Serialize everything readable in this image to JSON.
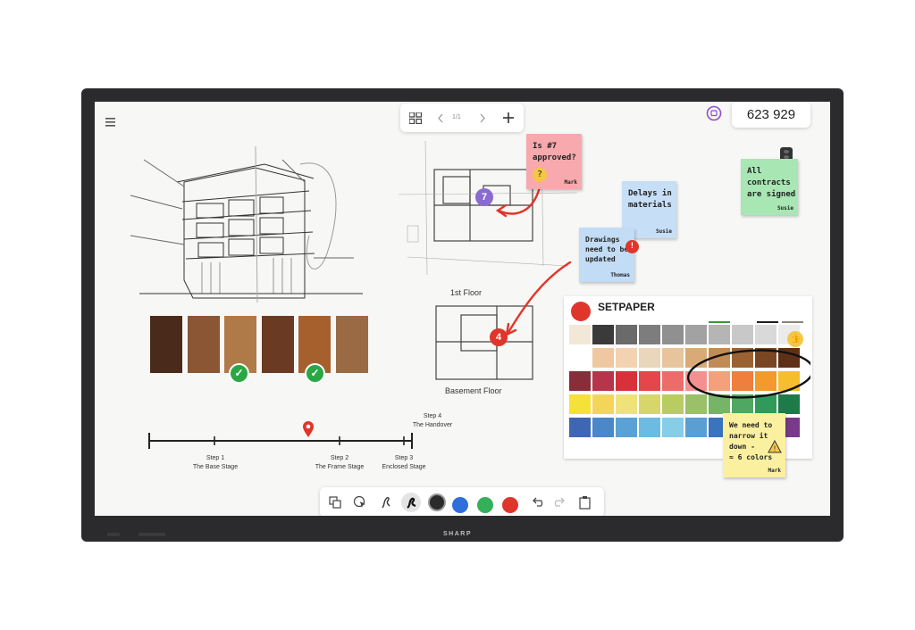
{
  "device": {
    "brand": "SHARP"
  },
  "toolbar_top": {
    "page_indicator": "1/1",
    "prev_icon": "chevron-left-icon",
    "next_icon": "chevron-right-icon",
    "add_icon": "plus-icon",
    "grid_icon": "grid-view-icon"
  },
  "session": {
    "code": "623 929"
  },
  "floorplan": {
    "label_1st": "1st Floor",
    "label_basement": "Basement Floor",
    "marker_top": "7",
    "marker_bottom": "4"
  },
  "notes": {
    "approved": {
      "text": "Is #7\napproved?",
      "author": "Mark"
    },
    "delays": {
      "text": "Delays in\nmaterials",
      "author": "Susie"
    },
    "drawings": {
      "text": "Drawings\nneed to be\nupdated",
      "author": "Thomas"
    },
    "contracts": {
      "text": "All\ncontracts\nare signed",
      "author": "Susie"
    },
    "narrow": {
      "text": "We need to\nnarrow it\ndown -\n≈ 6 colors",
      "author": "Mark"
    }
  },
  "palette": {
    "title": "SETPAPER"
  },
  "timeline": {
    "steps": [
      {
        "name": "Step 1",
        "label": "The Base Stage"
      },
      {
        "name": "Step 2",
        "label": "The Frame Stage"
      },
      {
        "name": "Step 3",
        "label": "Enclosed Stage"
      },
      {
        "name": "Step 4",
        "label": "The Handover"
      }
    ]
  },
  "colors": {
    "wood": [
      "#4a2a1a",
      "#8a5634",
      "#b07a48",
      "#6b3a22",
      "#a6602e",
      "#9a6a45"
    ],
    "accent_red": "#e0352b",
    "pen_colors": [
      "#2b2b2b",
      "#2f6fdc",
      "#35b05a",
      "#e0352b"
    ]
  },
  "toolbar_bottom": {
    "tools": [
      "copy-icon",
      "select-icon",
      "pen-icon",
      "marker-icon",
      "undo-icon",
      "redo-icon",
      "clipboard-icon"
    ]
  }
}
